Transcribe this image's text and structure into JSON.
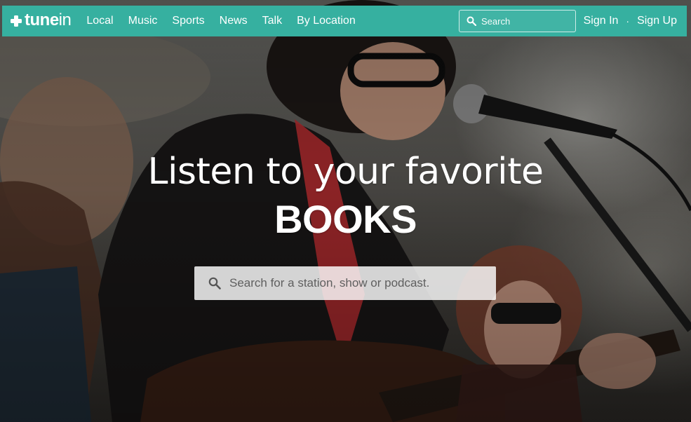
{
  "brand": {
    "logo_bold": "tune",
    "logo_light": "in",
    "color": "#36b0a0"
  },
  "nav": {
    "items": [
      {
        "label": "Local"
      },
      {
        "label": "Music"
      },
      {
        "label": "Sports"
      },
      {
        "label": "News"
      },
      {
        "label": "Talk"
      },
      {
        "label": "By Location"
      }
    ],
    "search_placeholder": "Search",
    "search_icon": "search-icon"
  },
  "auth": {
    "sign_in": "Sign In",
    "separator": "·",
    "sign_up": "Sign Up"
  },
  "hero": {
    "headline": "Listen to your favorite",
    "highlight": "BOOKS",
    "search_placeholder": "Search for a station, show or podcast.",
    "search_icon": "search-icon"
  }
}
